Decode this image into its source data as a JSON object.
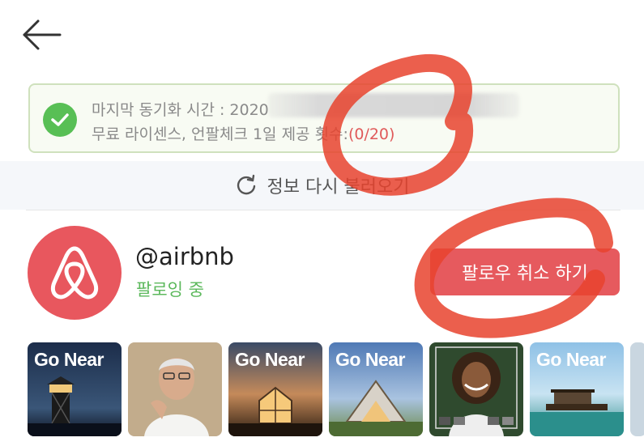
{
  "header": {
    "back_icon": "arrow-left-icon"
  },
  "sync": {
    "line1": "마지막 동기화 시간 : 2020",
    "line2_prefix": "무료 라이센스, 언팔체크 1일 제공 횟수:",
    "count": "(0/20)",
    "accent_color": "#58bf55",
    "count_color": "#e05a5a"
  },
  "reload": {
    "label": "정보 다시 불러오기",
    "icon": "refresh-icon"
  },
  "account": {
    "handle": "@airbnb",
    "status": "팔로잉 중",
    "unfollow_label": "팔로우 취소 하기",
    "brand_color": "#e8575e"
  },
  "thumbnails": [
    {
      "title": "Go Near",
      "scene": "lighthouse"
    },
    {
      "title": "",
      "scene": "portrait-man"
    },
    {
      "title": "Go Near",
      "scene": "glass-cabin"
    },
    {
      "title": "Go Near",
      "scene": "a-frame-cabin"
    },
    {
      "title": "",
      "scene": "portrait-woman"
    },
    {
      "title": "Go Near",
      "scene": "houseboat"
    }
  ]
}
